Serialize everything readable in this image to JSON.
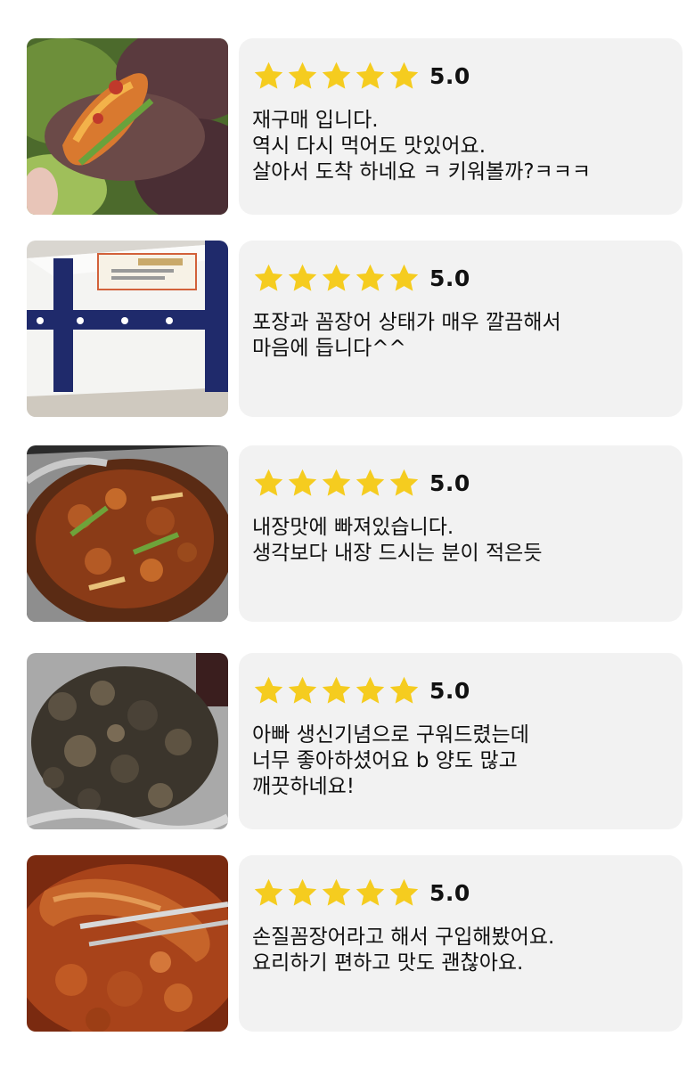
{
  "colors": {
    "star": "#f5cc1f",
    "card_background": "#f2f2f2",
    "text": "#111111"
  },
  "reviews": [
    {
      "photo_icon": "lettuce-wrap-photo",
      "stars": 5,
      "score": "5.0",
      "lines": [
        "재구매 입니다.",
        "역시 다시 먹어도 맛있어요.",
        "살아서 도착 하네요 ㅋ 키워볼까?ㅋㅋㅋ"
      ]
    },
    {
      "photo_icon": "delivery-box-photo",
      "stars": 5,
      "score": "5.0",
      "lines": [
        "포장과 꼼장어 상태가 매우 깔끔해서",
        "마음에 듭니다^^"
      ]
    },
    {
      "photo_icon": "stir-fry-photo",
      "stars": 5,
      "score": "5.0",
      "lines": [
        "내장맛에 빠져있습니다.",
        "생각보다 내장 드시는 분이 적은듯"
      ]
    },
    {
      "photo_icon": "grilled-eel-photo",
      "stars": 5,
      "score": "5.0",
      "lines": [
        "아빠 생신기념으로 구워드렸는데",
        "너무 좋아하셨어요 b 양도 많고",
        "깨끗하네요!"
      ]
    },
    {
      "photo_icon": "spicy-eel-photo",
      "stars": 5,
      "score": "5.0",
      "lines": [
        "손질꼼장어라고 해서 구입해봤어요.",
        "요리하기 편하고 맛도 괜찮아요."
      ]
    }
  ]
}
